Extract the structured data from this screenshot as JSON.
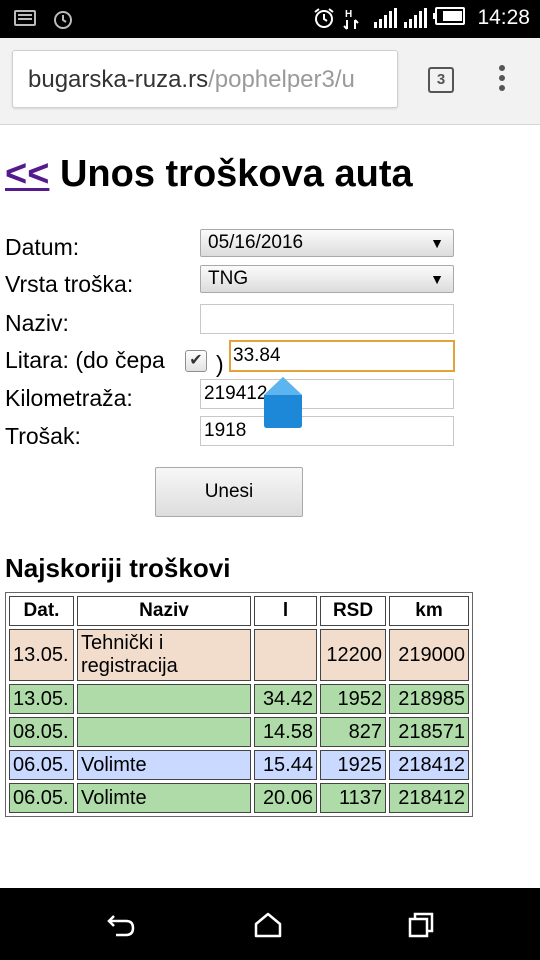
{
  "status_bar": {
    "time": "14:28",
    "icons": [
      "keyboard-icon",
      "alarm-icon",
      "alarm-clock-icon",
      "data-icon",
      "signal-icon",
      "signal-icon",
      "battery-icon"
    ]
  },
  "browser": {
    "url_host": "bugarska-ruza.rs",
    "url_path": "/pophelper3/u",
    "tab_count": "3"
  },
  "page": {
    "back_link": "<<",
    "title": "Unos troškova auta",
    "form": {
      "datum_label": "Datum:",
      "datum_value": "05/16/2016",
      "vrsta_label": "Vrsta troška:",
      "vrsta_value": "TNG",
      "naziv_label": "Naziv:",
      "naziv_value": "",
      "litara_label": "Litara: (do čepa",
      "litara_paren": ")",
      "litara_value": "33.84",
      "km_label": "Kilometraža:",
      "km_value": "219412",
      "trosak_label": "Trošak:",
      "trosak_value": "1918",
      "submit_label": "Unesi"
    },
    "recent_heading": "Najskoriji troškovi",
    "table": {
      "headers": [
        "Dat.",
        "Naziv",
        "l",
        "RSD",
        "km"
      ],
      "rows": [
        {
          "dat": "13.05.",
          "naziv": "Tehnički i registracija",
          "l": "",
          "rsd": "12200",
          "km": "219000",
          "color": "#f2ddcd"
        },
        {
          "dat": "13.05.",
          "naziv": "",
          "l": "34.42",
          "rsd": "1952",
          "km": "218985",
          "color": "#aedba8"
        },
        {
          "dat": "08.05.",
          "naziv": "",
          "l": "14.58",
          "rsd": "827",
          "km": "218571",
          "color": "#aedba8"
        },
        {
          "dat": "06.05.",
          "naziv": "Volimte",
          "l": "15.44",
          "rsd": "1925",
          "km": "218412",
          "color": "#cad9ff"
        },
        {
          "dat": "06.05.",
          "naziv": "Volimte",
          "l": "20.06",
          "rsd": "1137",
          "km": "218412",
          "color": "#aedba8"
        }
      ]
    }
  },
  "colors": {
    "link": "#551a8b",
    "focus_border": "#e3a23a",
    "handle": "#1e88d8"
  }
}
